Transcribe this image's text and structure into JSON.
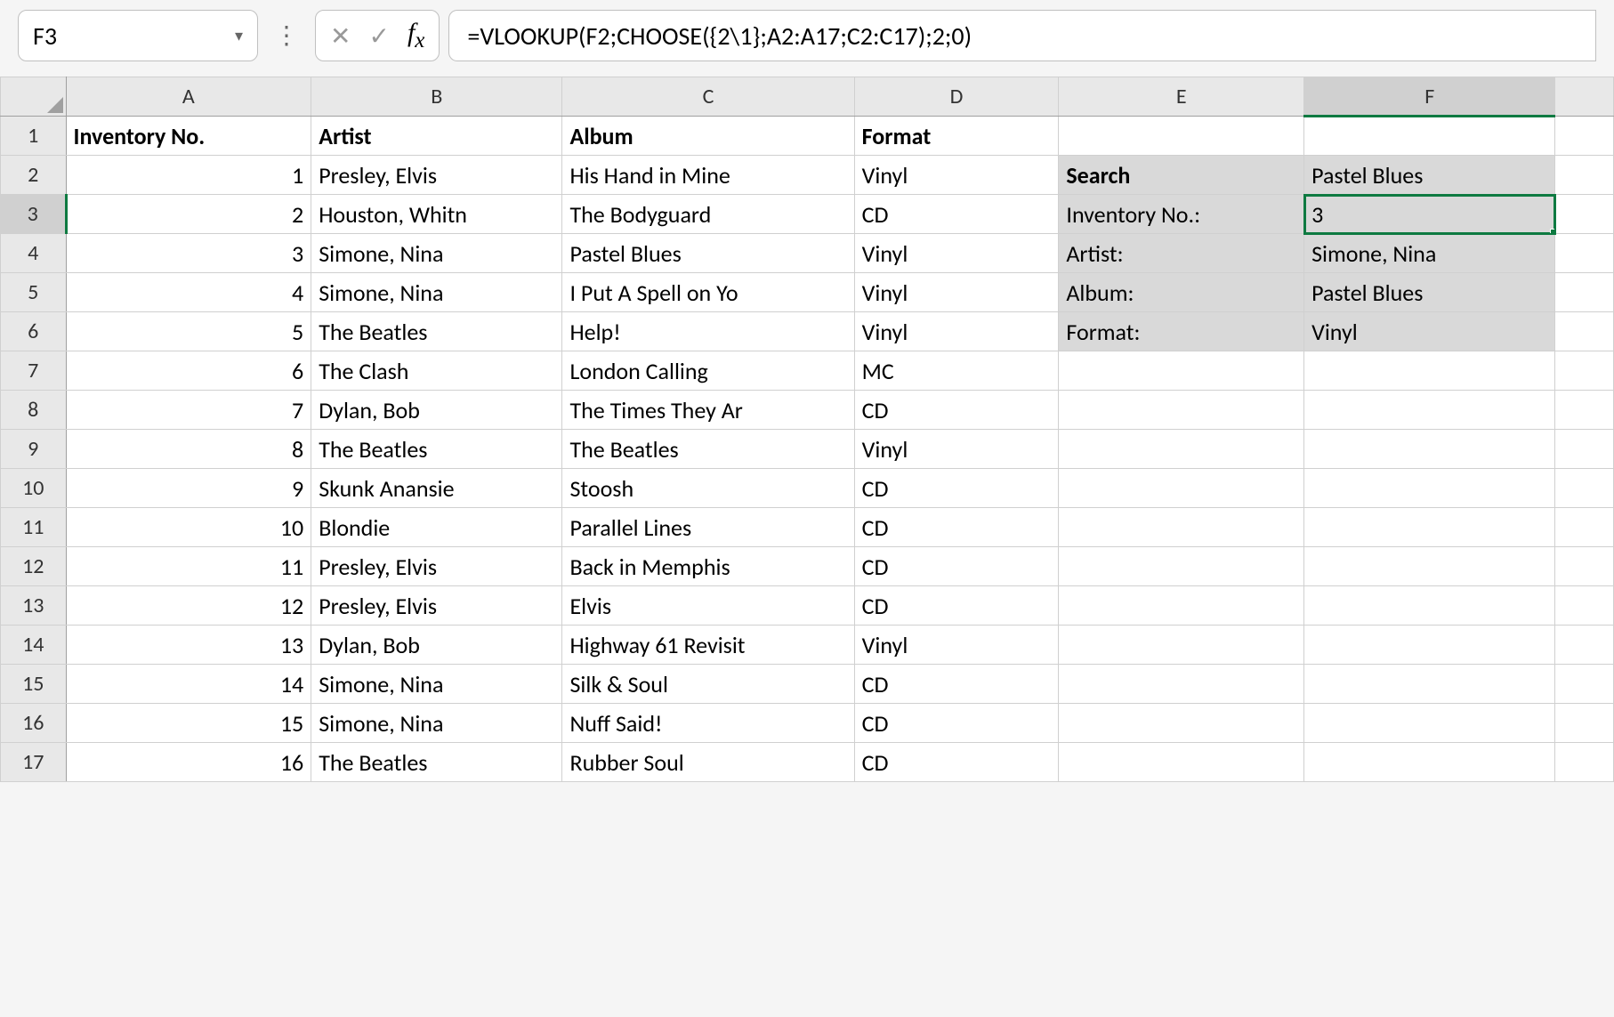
{
  "nameBox": "F3",
  "formula": "=VLOOKUP(F2;CHOOSE({2\\1};A2:A17;C2:C17);2;0)",
  "columns": [
    "A",
    "B",
    "C",
    "D",
    "E",
    "F"
  ],
  "rowCount": 17,
  "selectedCell": {
    "row": 3,
    "col": "F"
  },
  "headers": {
    "A": "Inventory No.",
    "B": "Artist",
    "C": "Album",
    "D": "Format"
  },
  "data": [
    {
      "inv": "1",
      "artist": "Presley, Elvis",
      "album": "His Hand in Mine",
      "format": "Vinyl"
    },
    {
      "inv": "2",
      "artist": "Houston, Whitn",
      "album": "The Bodyguard",
      "format": "CD"
    },
    {
      "inv": "3",
      "artist": "Simone, Nina",
      "album": "Pastel Blues",
      "format": "Vinyl"
    },
    {
      "inv": "4",
      "artist": "Simone, Nina",
      "album": "I Put A Spell on Yo",
      "format": "Vinyl"
    },
    {
      "inv": "5",
      "artist": "The Beatles",
      "album": "Help!",
      "format": "Vinyl"
    },
    {
      "inv": "6",
      "artist": "The Clash",
      "album": "London Calling",
      "format": "MC"
    },
    {
      "inv": "7",
      "artist": "Dylan, Bob",
      "album": "The Times They Ar",
      "format": "CD"
    },
    {
      "inv": "8",
      "artist": "The Beatles",
      "album": "The Beatles",
      "format": "Vinyl"
    },
    {
      "inv": "9",
      "artist": "Skunk Anansie",
      "album": "Stoosh",
      "format": "CD"
    },
    {
      "inv": "10",
      "artist": "Blondie",
      "album": "Parallel Lines",
      "format": "CD"
    },
    {
      "inv": "11",
      "artist": "Presley, Elvis",
      "album": "Back in Memphis",
      "format": "CD"
    },
    {
      "inv": "12",
      "artist": "Presley, Elvis",
      "album": "Elvis",
      "format": "CD"
    },
    {
      "inv": "13",
      "artist": "Dylan, Bob",
      "album": "Highway 61 Revisit",
      "format": "Vinyl"
    },
    {
      "inv": "14",
      "artist": "Simone, Nina",
      "album": "Silk & Soul",
      "format": "CD"
    },
    {
      "inv": "15",
      "artist": "Simone, Nina",
      "album": "Nuff Said!",
      "format": "CD"
    },
    {
      "inv": "16",
      "artist": "The Beatles",
      "album": "Rubber Soul",
      "format": "CD"
    }
  ],
  "lookup": {
    "searchLabel": "Search",
    "searchValue": "Pastel Blues",
    "invLabel": "Inventory No.:",
    "invResult": "3",
    "artistLabel": "Artist:",
    "artistResult": "Simone, Nina",
    "albumLabel": "Album:",
    "albumResult": "Pastel Blues",
    "formatLabel": "Format:",
    "formatResult": "Vinyl"
  }
}
